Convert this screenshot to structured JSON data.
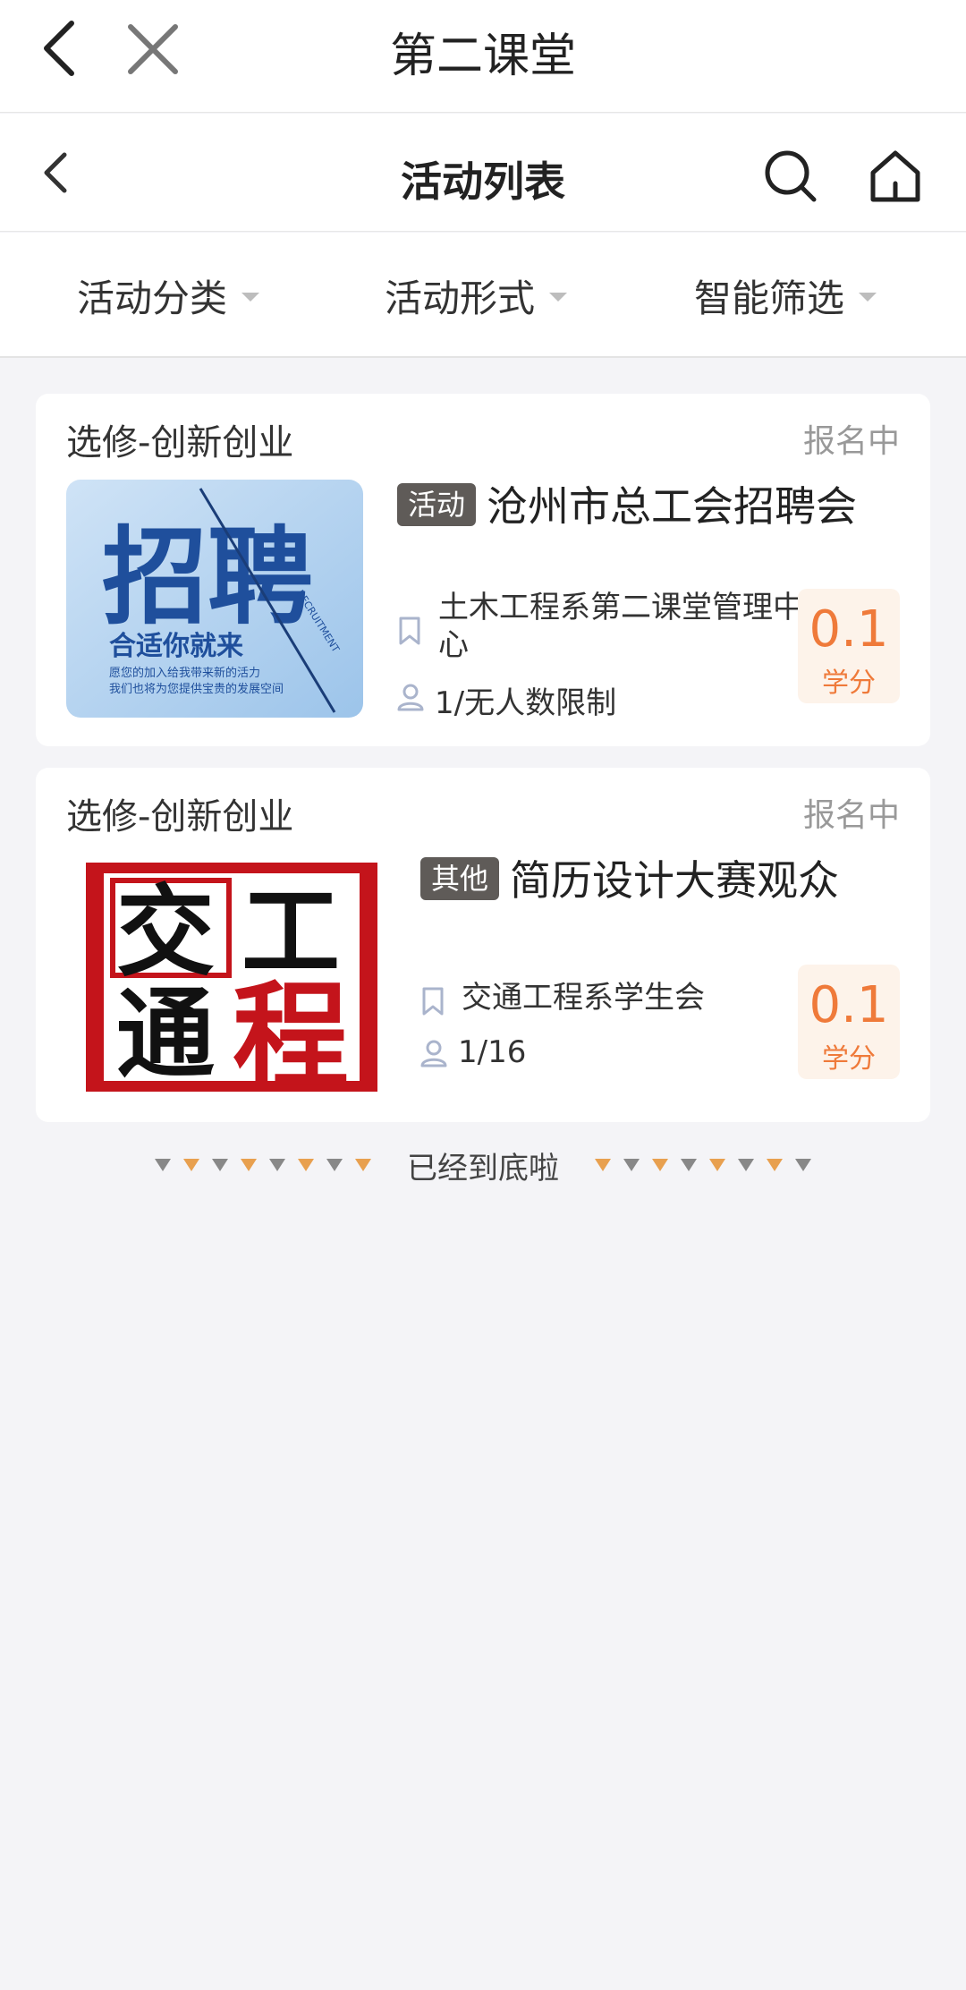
{
  "app": {
    "title": "第二课堂"
  },
  "header": {
    "title": "活动列表"
  },
  "filters": [
    "活动分类",
    "活动形式",
    "智能筛选"
  ],
  "activities": [
    {
      "category": "选修-创新创业",
      "status": "报名中",
      "tag": "活动",
      "title": "沧州市总工会招聘会",
      "organizer": "土木工程系第二课堂管理中心",
      "participants": "1/无人数限制",
      "credit": "0.1",
      "credit_unit": "学分",
      "image": {
        "big": "招聘",
        "line1": "合适你就来",
        "line2": "愿您的加入给我带来新的活力",
        "line3": "我们也将为您提供宝贵的发展空间",
        "side": "RECRUITMENT"
      }
    },
    {
      "category": "选修-创新创业",
      "status": "报名中",
      "tag": "其他",
      "title": "简历设计大赛观众",
      "organizer": "交通工程系学生会",
      "participants": "1/16",
      "credit": "0.1",
      "credit_unit": "学分",
      "image": {
        "chars": [
          "交",
          "工",
          "通",
          "程"
        ]
      }
    }
  ],
  "list_end": "已经到底啦",
  "colors": {
    "accent": "#ef7a3a",
    "tag_bg": "#5f5b58",
    "credit_bg": "#fdf3ea"
  }
}
